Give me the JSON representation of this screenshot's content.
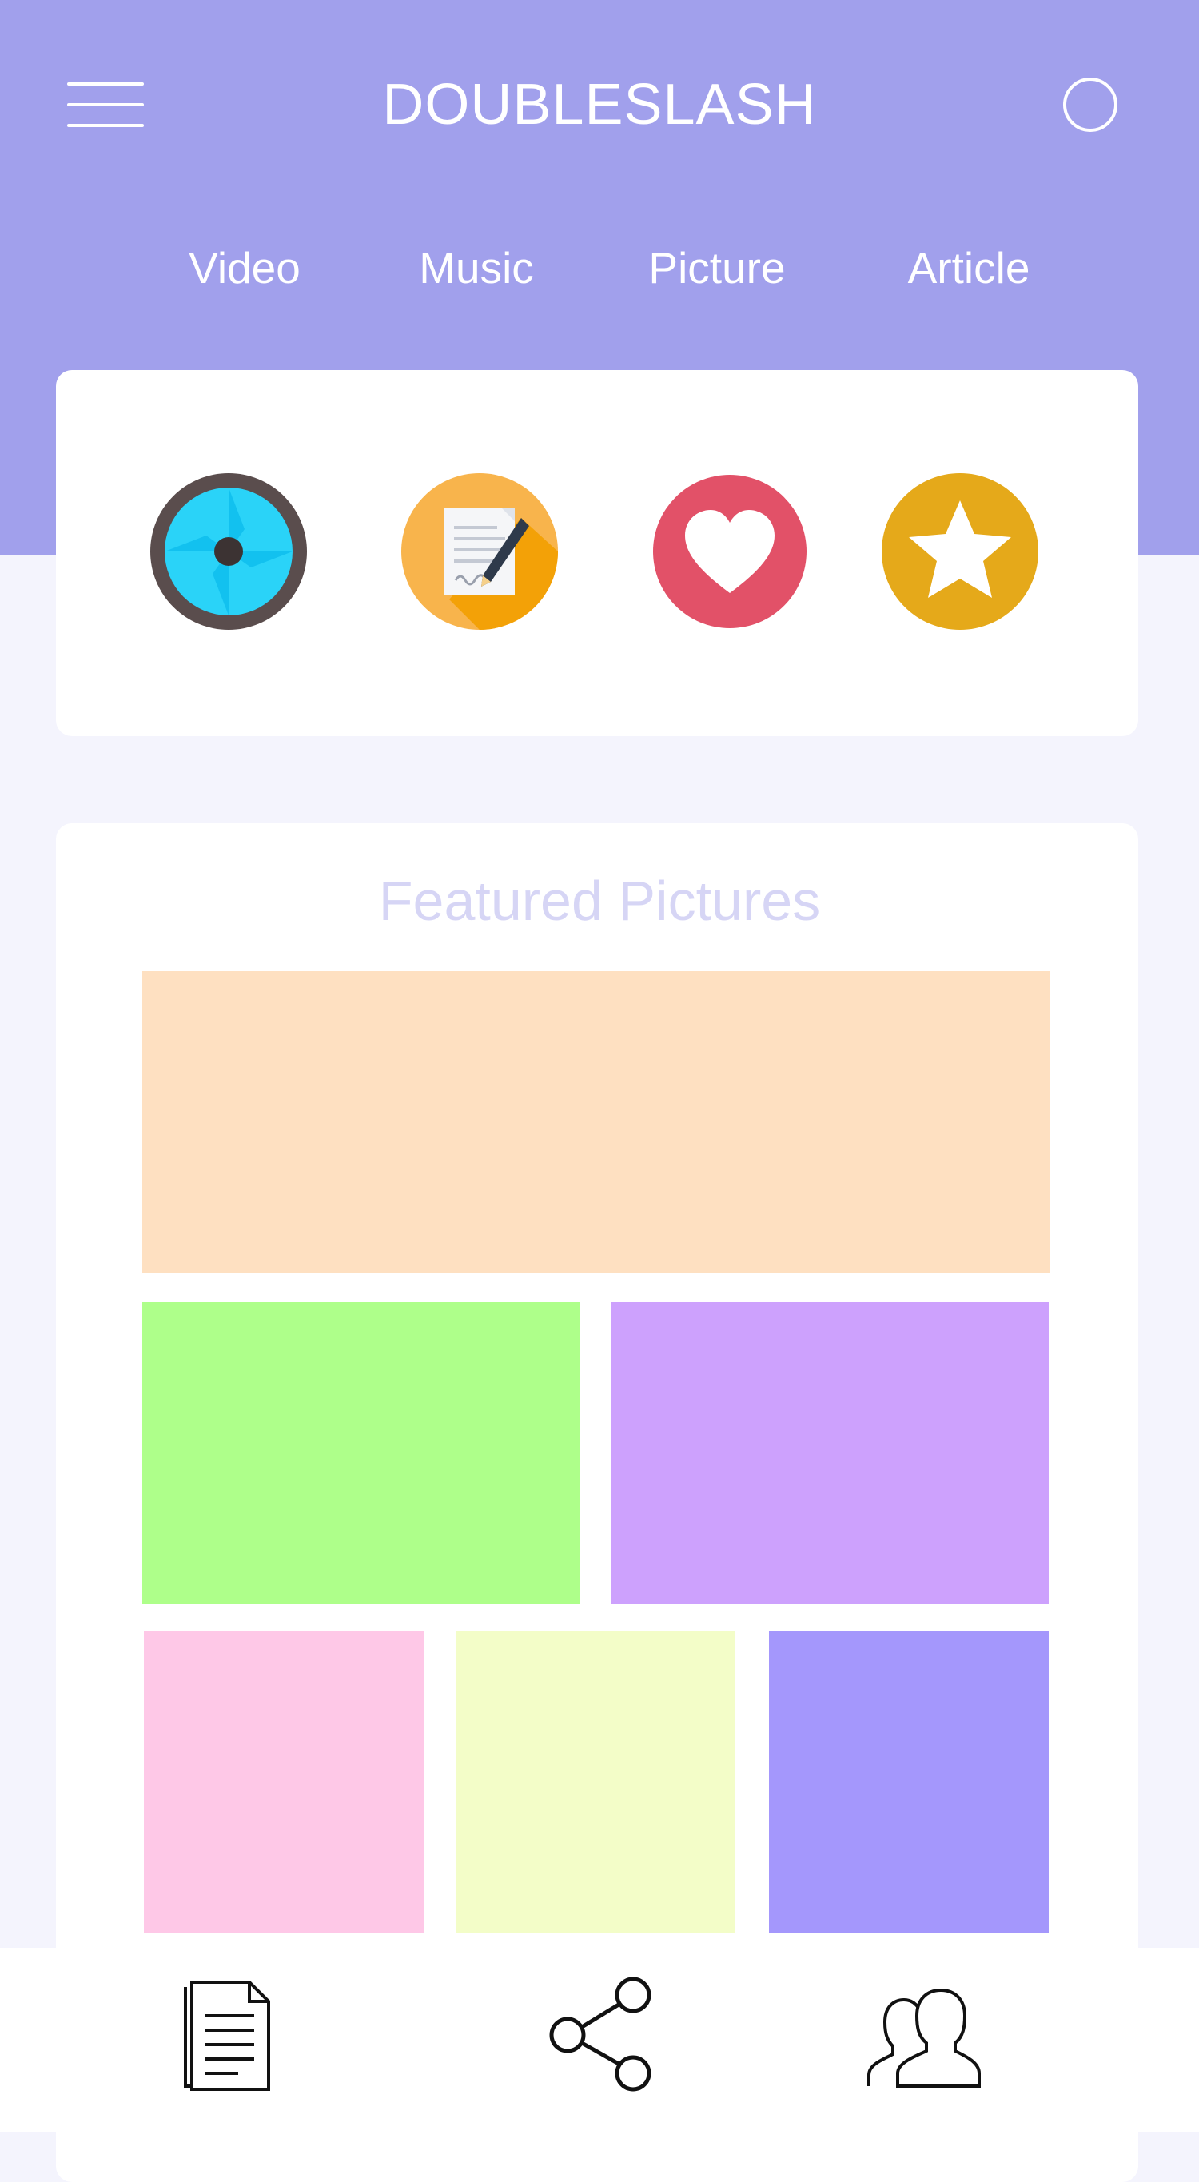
{
  "header": {
    "title": "DOUBLESLASH",
    "menu_icon": "hamburger-menu-icon",
    "search_icon": "search-circle-icon",
    "bg_color": "#a1a0ec"
  },
  "nav": {
    "tabs": [
      {
        "label": "Video"
      },
      {
        "label": "Music"
      },
      {
        "label": "Picture"
      },
      {
        "label": "Article"
      }
    ]
  },
  "categories": {
    "icons": [
      "camera-shutter-icon",
      "document-pen-icon",
      "heart-icon",
      "star-icon"
    ]
  },
  "featured": {
    "title": "Featured Pictures",
    "tile_colors": [
      "#fee0c1",
      "#aeff8a",
      "#cda1fd",
      "#fec8e7",
      "#f3fdc8",
      "#a497fc"
    ]
  },
  "bottom_nav": {
    "icons": [
      "document-icon",
      "share-icon",
      "users-icon"
    ]
  }
}
